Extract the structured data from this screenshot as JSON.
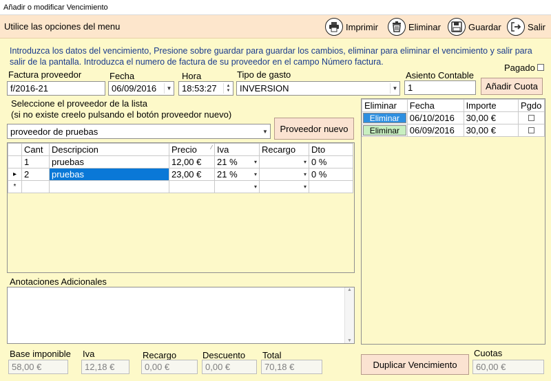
{
  "window": {
    "title": "Añadir o modificar Vencimiento"
  },
  "menu": {
    "hint": "Utilice las opciones del menu",
    "buttons": [
      {
        "label": "Imprimir",
        "icon": "printer-icon"
      },
      {
        "label": "Eliminar",
        "icon": "trash-icon"
      },
      {
        "label": "Guardar",
        "icon": "floppy-disk-icon"
      },
      {
        "label": "Salir",
        "icon": "exit-icon"
      }
    ]
  },
  "intro": "Introduzca los datos del vencimiento, Presione sobre guardar para guardar los cambios, eliminar para eliminar el vencimiento y salir para salir de la pantalla. Introduzca el numero de factura de su proveedor en el campo Número factura.",
  "form": {
    "factura_label": "Factura proveedor",
    "factura_value": "f/2016-21",
    "fecha_label": "Fecha",
    "fecha_value": "06/09/2016",
    "hora_label": "Hora",
    "hora_value": "18:53:27",
    "tipo_label": "Tipo de gasto",
    "tipo_value": "INVERSION",
    "asiento_label": "Asiento Contable",
    "asiento_value": "1",
    "pagado_label": "Pagado",
    "add_cuota_label": "Añadir Cuota",
    "proveedor_hint1": "Seleccione el proveedor de la lista",
    "proveedor_hint2": "(si no existe creelo pulsando el botón proveedor nuevo)",
    "proveedor_value": "proveedor de pruebas",
    "proveedor_nuevo_label": "Proveedor nuevo",
    "anotaciones_label": "Anotaciones Adicionales",
    "anotaciones_value": ""
  },
  "lines": {
    "headers": [
      "Cant",
      "Descripcion",
      "Precio",
      "Iva",
      "Recargo",
      "Dto"
    ],
    "rows": [
      {
        "cant": "1",
        "desc": "pruebas",
        "precio": "12,00 €",
        "iva": "21 %",
        "recargo": "",
        "dto": "0 %"
      },
      {
        "cant": "2",
        "desc": "pruebas",
        "precio": "23,00 €",
        "iva": "21 %",
        "recargo": "",
        "dto": "0 %"
      }
    ],
    "current_marker": "▸",
    "new_marker": "*"
  },
  "cuotas": {
    "headers": [
      "Eliminar",
      "Fecha",
      "Importe",
      "Pgdo"
    ],
    "rows": [
      {
        "btn": "Eliminar",
        "fecha": "06/10/2016",
        "importe": "30,00 €",
        "btn_color": "#2e8fe0"
      },
      {
        "btn": "Eliminar",
        "fecha": "06/09/2016",
        "importe": "30,00 €",
        "btn_color": "#c8efc0"
      }
    ]
  },
  "totals": {
    "base_label": "Base imponible",
    "base_value": "58,00 €",
    "iva_label": "Iva",
    "iva_value": "12,18 €",
    "recargo_label": "Recargo",
    "recargo_value": "0,00 €",
    "descuento_label": "Descuento",
    "descuento_value": "0,00 €",
    "total_label": "Total",
    "total_value": "70,18 €",
    "cuotas_label": "Cuotas",
    "cuotas_value": "60,00 €",
    "duplicar_label": "Duplicar Vencimiento"
  },
  "colors": {
    "menubar": "#fde6cc",
    "panel": "#fdf9c9",
    "intro_text": "#1a3b8c",
    "selection": "#0a78d7"
  }
}
